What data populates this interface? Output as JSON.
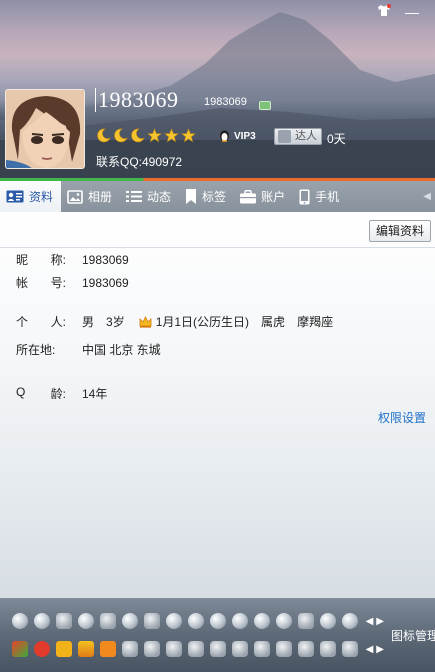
{
  "window": {
    "skin_icon": "shirt-icon",
    "minimize_glyph": "—"
  },
  "profile": {
    "nickname": "1983069",
    "qq_small": "1983069",
    "vip_label": "VIP3",
    "daren_label": "达人",
    "days": "0天",
    "contact_qq": "联系QQ:490972",
    "level_icons": [
      "moon",
      "moon",
      "moon",
      "star",
      "star",
      "star"
    ]
  },
  "tabs": [
    {
      "label": "资料",
      "icon": "profile-card-icon",
      "active": true
    },
    {
      "label": "相册",
      "icon": "photo-icon"
    },
    {
      "label": "动态",
      "icon": "feed-icon"
    },
    {
      "label": "标签",
      "icon": "bookmark-icon"
    },
    {
      "label": "账户",
      "icon": "briefcase-icon"
    },
    {
      "label": "手机",
      "icon": "phone-icon"
    }
  ],
  "edit_button": "编辑资料",
  "info": {
    "nickname_label_1": "昵",
    "nickname_label_2": "称:",
    "nickname_value": "1983069",
    "account_label_1": "帐",
    "account_label_2": "号:",
    "account_value": "1983069",
    "personal_label_1": "个",
    "personal_label_2": "人:",
    "gender": "男",
    "age_years": "3岁",
    "birthday": "1月1日(公历生日)",
    "zodiac": "属虎",
    "constellation": "摩羯座",
    "location_label": "所在地:",
    "location_value": "中国 北京 东城",
    "qage_label_1": "Q",
    "qage_label_2": "龄:",
    "qage_value": "14年"
  },
  "permission_link": "权限设置",
  "icon_manage": "图标管理",
  "colors": {
    "accent": "#1e6fc9",
    "tab_active_text": "#2a5aa8",
    "header_dark": "#3c4552"
  }
}
